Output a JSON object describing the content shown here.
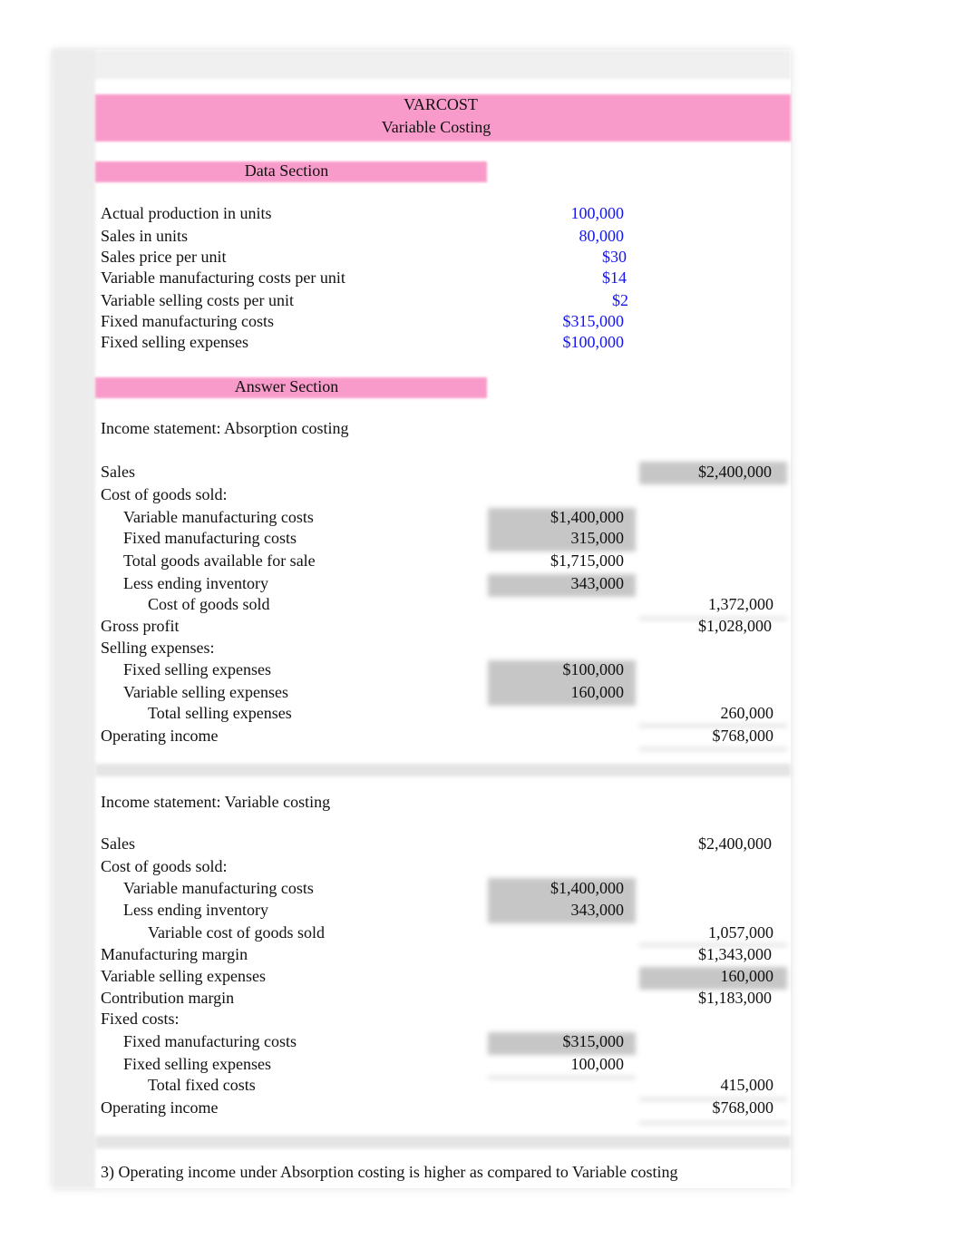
{
  "header": {
    "title": "VARCOST",
    "subtitle": "Variable Costing"
  },
  "data_section": {
    "heading": "Data Section",
    "items": [
      {
        "label": "Actual production in units",
        "value": "100,000"
      },
      {
        "label": "Sales in units",
        "value": "80,000"
      },
      {
        "label": "Sales price per unit",
        "value": "$30"
      },
      {
        "label": "Variable manufacturing costs per unit",
        "value": "$14"
      },
      {
        "label": "Variable selling costs per unit",
        "value": "$2"
      },
      {
        "label": "Fixed manufacturing costs",
        "value": "$315,000"
      },
      {
        "label": "Fixed selling expenses",
        "value": "$100,000"
      }
    ]
  },
  "answer_section": {
    "heading": "Answer Section",
    "absorption": {
      "heading": "Income statement: Absorption costing",
      "rows": [
        {
          "label": "Sales",
          "b": "",
          "c": "$2,400,000"
        },
        {
          "label": "Cost of goods sold:",
          "b": "",
          "c": ""
        },
        {
          "label": "Variable manufacturing costs",
          "b": "$1,400,000",
          "c": ""
        },
        {
          "label": "Fixed manufacturing costs",
          "b": "315,000",
          "c": ""
        },
        {
          "label": "Total goods available for sale",
          "b": "$1,715,000",
          "c": ""
        },
        {
          "label": "Less ending inventory",
          "b": "343,000",
          "c": ""
        },
        {
          "label": "Cost of goods sold",
          "b": "",
          "c": "1,372,000"
        },
        {
          "label": "Gross profit",
          "b": "",
          "c": "$1,028,000"
        },
        {
          "label": "Selling expenses:",
          "b": "",
          "c": ""
        },
        {
          "label": "Fixed selling expenses",
          "b": "$100,000",
          "c": ""
        },
        {
          "label": "Variable selling expenses",
          "b": "160,000",
          "c": ""
        },
        {
          "label": "Total selling expenses",
          "b": "",
          "c": "260,000"
        },
        {
          "label": "Operating income",
          "b": "",
          "c": "$768,000"
        }
      ]
    },
    "variable": {
      "heading": "Income statement: Variable costing",
      "rows": [
        {
          "label": "Sales",
          "b": "",
          "c": "$2,400,000"
        },
        {
          "label": "Cost of goods sold:",
          "b": "",
          "c": ""
        },
        {
          "label": "Variable manufacturing costs",
          "b": "$1,400,000",
          "c": ""
        },
        {
          "label": "Less ending inventory",
          "b": "343,000",
          "c": ""
        },
        {
          "label": "Variable cost of goods sold",
          "b": "",
          "c": "1,057,000"
        },
        {
          "label": "Manufacturing margin",
          "b": "",
          "c": "$1,343,000"
        },
        {
          "label": "Variable selling expenses",
          "b": "",
          "c": "160,000"
        },
        {
          "label": "Contribution margin",
          "b": "",
          "c": "$1,183,000"
        },
        {
          "label": "Fixed costs:",
          "b": "",
          "c": ""
        },
        {
          "label": "Fixed manufacturing costs",
          "b": "$315,000",
          "c": ""
        },
        {
          "label": "Fixed selling expenses",
          "b": "100,000",
          "c": ""
        },
        {
          "label": "Total fixed costs",
          "b": "",
          "c": "415,000"
        },
        {
          "label": "Operating income",
          "b": "",
          "c": "$768,000"
        }
      ]
    },
    "note": "3) Operating income under Absorption costing is higher as compared to Variable costing"
  }
}
